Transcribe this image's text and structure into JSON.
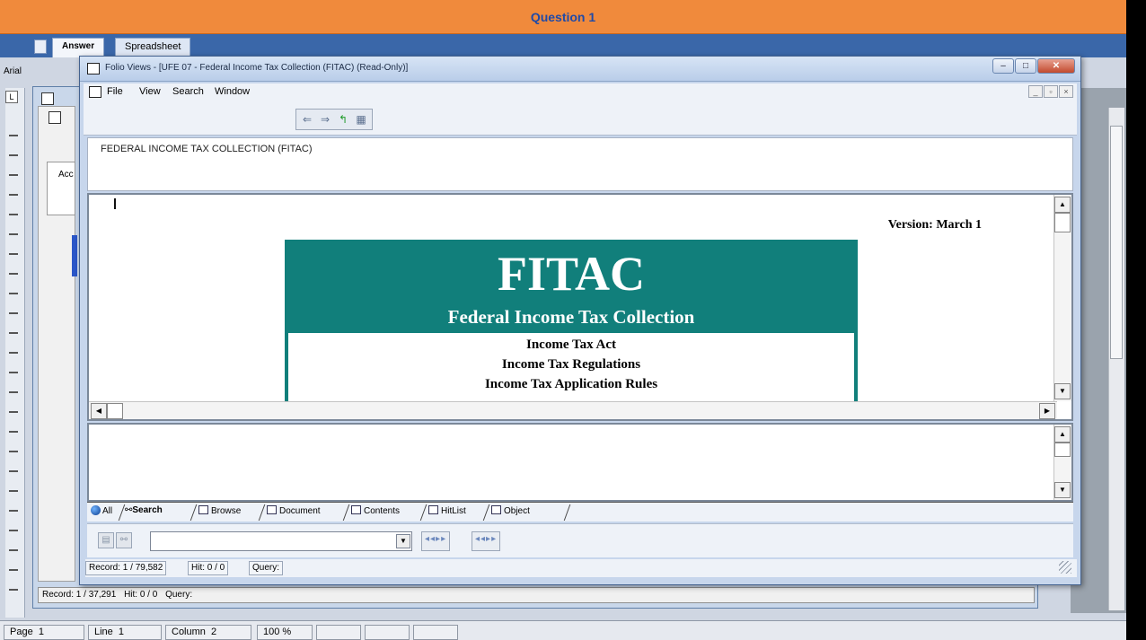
{
  "app": {
    "title": "Question 1",
    "tabs": [
      "Answer",
      "Spreadsheet"
    ],
    "font_name": "Arial",
    "ruler_box": "L"
  },
  "back_window": {
    "side_label": "Acc",
    "status": {
      "record": "Record: 1 / 37,291",
      "hit": "Hit: 0 / 0",
      "query": "Query:"
    }
  },
  "word_status": {
    "page": "Page",
    "page_num": "1",
    "line": "Line",
    "line_num": "1",
    "column": "Column",
    "column_num": "2",
    "zoom": "100 %"
  },
  "folio": {
    "title": "Folio Views - [UFE 07 - Federal Income Tax Collection (FITAC) (Read-Only)]",
    "menu": [
      "File",
      "View",
      "Search",
      "Window"
    ],
    "toolbar_icons": [
      "back-arrow-icon",
      "forward-arrow-icon",
      "jump-back-icon",
      "split-view-icon"
    ],
    "header_text": "FEDERAL INCOME TAX COLLECTION (FITAC)",
    "document": {
      "version": "Version: March 1",
      "banner_title": "FITAC",
      "banner_subtitle": "Federal Income Tax Collection",
      "items": [
        "Income Tax Act",
        "Income Tax Regulations",
        "Income Tax Application Rules"
      ]
    },
    "view_tabs": [
      {
        "label": "All",
        "icon": "globe-icon"
      },
      {
        "label": "Search",
        "icon": "binoculars-icon"
      },
      {
        "label": "Browse",
        "icon": "browse-icon"
      },
      {
        "label": "Document",
        "icon": "document-icon"
      },
      {
        "label": "Contents",
        "icon": "contents-icon"
      },
      {
        "label": "HitList",
        "icon": "hitlist-icon"
      },
      {
        "label": "Object",
        "icon": "object-icon"
      }
    ],
    "query_input": "",
    "status": {
      "record": "Record: 1 / 79,582",
      "hit": "Hit: 0 / 0",
      "query": "Query:"
    }
  },
  "colors": {
    "title_bar": "#f08a3c",
    "banner": "#117f7b",
    "title_text": "#1f4aa8"
  }
}
